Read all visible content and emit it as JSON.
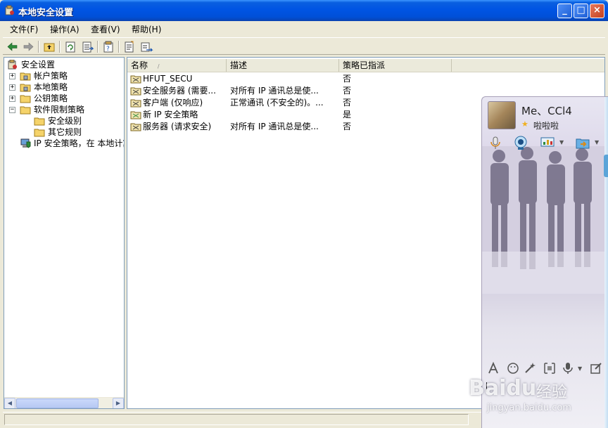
{
  "window": {
    "title": "本地安全设置",
    "minimize": "_",
    "maximize": "□",
    "close": "×"
  },
  "menu": [
    {
      "label": "文件(F)"
    },
    {
      "label": "操作(A)"
    },
    {
      "label": "查看(V)"
    },
    {
      "label": "帮助(H)"
    }
  ],
  "toolbar": [
    "back-arrow-icon",
    "forward-arrow-icon",
    "up-folder-icon",
    "refresh-icon",
    "export-list-icon",
    "properties-icon",
    "help-icon",
    "import-icon"
  ],
  "tree": {
    "expanders": {
      "collapsed": "+",
      "expanded": "−"
    },
    "root": "安全设置",
    "items": [
      {
        "label": "帐户策略",
        "expander": "collapsed"
      },
      {
        "label": "本地策略",
        "expander": "collapsed"
      },
      {
        "label": "公钥策略",
        "expander": "collapsed"
      },
      {
        "label": "软件限制策略",
        "expander": "expanded"
      },
      {
        "label": "安全级别"
      },
      {
        "label": "其它规则"
      },
      {
        "label": "IP 安全策略，在 本地计算机"
      }
    ],
    "scroll_left": "◀",
    "scroll_right": "▶"
  },
  "list": {
    "columns": {
      "name": "名称",
      "sort": "/",
      "desc": "描述",
      "assigned": "策略已指派"
    },
    "rows": [
      {
        "name": "HFUT_SECU",
        "desc": "",
        "assigned": "否"
      },
      {
        "name": "安全服务器 (需要...",
        "desc": "对所有 IP 通讯总是使...",
        "assigned": "否"
      },
      {
        "name": "客户端 (仅响应)",
        "desc": "正常通讯 (不安全的)。...",
        "assigned": "否"
      },
      {
        "name": "新 IP 安全策略",
        "desc": "",
        "assigned": "是"
      },
      {
        "name": "服务器 (请求安全)",
        "desc": "对所有 IP 通讯总是使...",
        "assigned": "否"
      }
    ]
  },
  "chat": {
    "name": "Me、CCl4",
    "star": "★",
    "status": "啦啦啦",
    "dropdown_arrow": "▼"
  },
  "watermark": {
    "logo": "Baidu",
    "cn": "经验",
    "url": "jingyan.baidu.com"
  }
}
